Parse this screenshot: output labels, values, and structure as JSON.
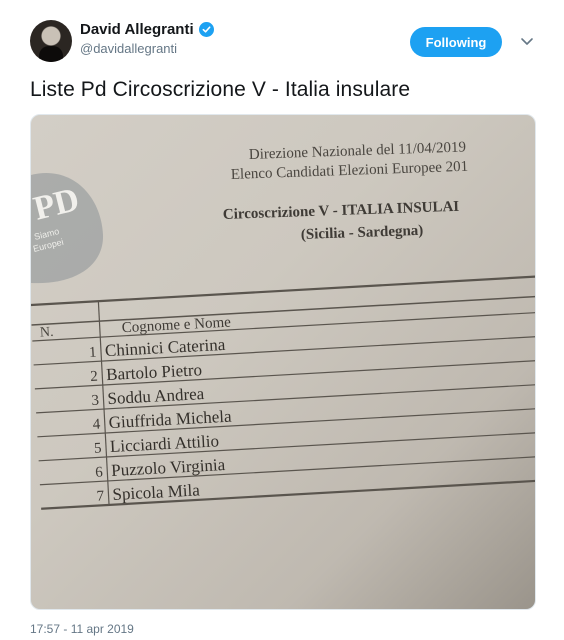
{
  "tweet": {
    "author": {
      "name": "David Allegranti",
      "handle": "@davidallegranti",
      "verified": true,
      "avatar_icon": "avatar-photo"
    },
    "follow_label": "Following",
    "text": "Liste Pd Circoscrizione V - Italia insulare",
    "timestamp": "17:57 - 11 apr 2019"
  },
  "photo": {
    "logo": {
      "mark": "PD",
      "tagline_1": "Siamo",
      "tagline_2": "Europei"
    },
    "header_line_1": "Direzione Nazionale del 11/04/2019",
    "header_line_2": "Elenco Candidati Elezioni Europee 201",
    "section_title": "Circoscrizione V - ITALIA INSULAI",
    "section_subtitle": "(Sicilia - Sardegna)",
    "table": {
      "col_number": "N.",
      "col_name": "Cognome e Nome",
      "rows": [
        {
          "n": "1",
          "name": "Chinnici Caterina"
        },
        {
          "n": "2",
          "name": "Bartolo Pietro"
        },
        {
          "n": "3",
          "name": "Soddu Andrea"
        },
        {
          "n": "4",
          "name": "Giuffrida Michela"
        },
        {
          "n": "5",
          "name": "Licciardi Attilio"
        },
        {
          "n": "6",
          "name": "Puzzolo Virginia"
        },
        {
          "n": "7",
          "name": "Spicola Mila"
        }
      ]
    }
  },
  "colors": {
    "accent": "#1da1f2",
    "text": "#14171a",
    "secondary": "#657786"
  }
}
